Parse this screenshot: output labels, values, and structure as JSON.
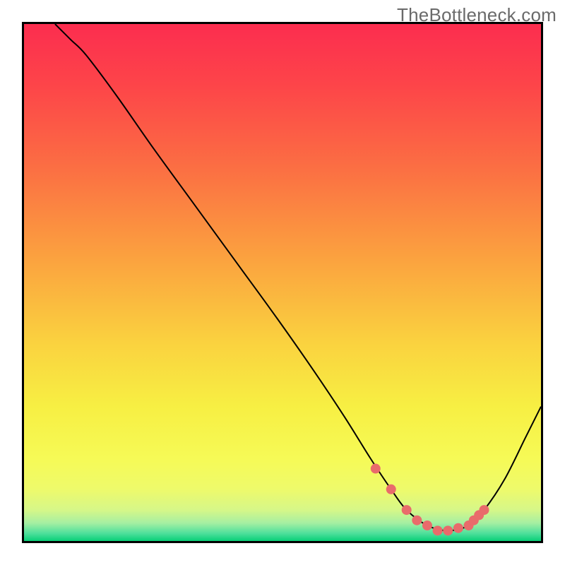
{
  "watermark": "TheBottleneck.com",
  "colors": {
    "border": "#000000",
    "curve": "#000000",
    "marker": "#e96b6b",
    "gradient_stops": [
      {
        "offset": 0.0,
        "color": "#fc2d4f"
      },
      {
        "offset": 0.12,
        "color": "#fd4549"
      },
      {
        "offset": 0.28,
        "color": "#fb6f43"
      },
      {
        "offset": 0.45,
        "color": "#fba13f"
      },
      {
        "offset": 0.62,
        "color": "#fad33f"
      },
      {
        "offset": 0.74,
        "color": "#f7ef43"
      },
      {
        "offset": 0.84,
        "color": "#f6fa56"
      },
      {
        "offset": 0.9,
        "color": "#eefa6b"
      },
      {
        "offset": 0.94,
        "color": "#d6f788"
      },
      {
        "offset": 0.965,
        "color": "#a6efa2"
      },
      {
        "offset": 0.985,
        "color": "#4fe09c"
      },
      {
        "offset": 1.0,
        "color": "#08cf77"
      }
    ]
  },
  "chart_data": {
    "type": "line",
    "title": "",
    "xlabel": "",
    "ylabel": "",
    "xlim": [
      0,
      100
    ],
    "ylim": [
      0,
      100
    ],
    "note": "Axes are normalized 0–100 to the inner plot. The line is a bottleneck curve: starts at top-left, falls quasi-linearly to a broad minimum near x≈72–86, then rises toward the right edge.",
    "series": [
      {
        "name": "bottleneck-curve",
        "x": [
          6,
          9,
          12,
          18,
          25,
          33,
          41,
          49,
          56,
          62,
          67,
          71,
          74,
          78,
          82,
          86,
          89,
          93,
          97,
          100
        ],
        "y": [
          100,
          97,
          94,
          86,
          76,
          65,
          54,
          43,
          33,
          24,
          16,
          10,
          6,
          3,
          2,
          3,
          6,
          12,
          20,
          26
        ]
      }
    ],
    "markers": {
      "name": "highlight-points",
      "color": "#e96b6b",
      "x": [
        68,
        71,
        74,
        76,
        78,
        80,
        82,
        84,
        86,
        87,
        88,
        89
      ],
      "y": [
        14,
        10,
        6,
        4,
        3,
        2,
        2,
        2.5,
        3,
        4,
        5,
        6
      ]
    }
  }
}
